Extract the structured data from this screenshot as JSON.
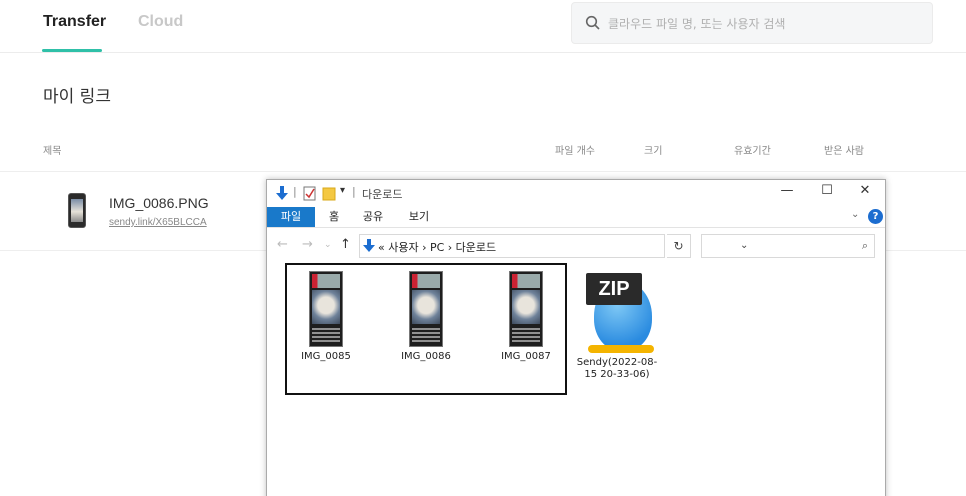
{
  "header": {
    "tabs": [
      {
        "label": "Transfer",
        "active": true
      },
      {
        "label": "Cloud",
        "active": false
      }
    ],
    "search_placeholder": "클라우드 파일 명, 또는 사용자 검색"
  },
  "main": {
    "title": "마이 링크",
    "columns": [
      "제목",
      "파일 개수",
      "크기",
      "유효기간",
      "받은 사람"
    ],
    "rows": [
      {
        "name": "IMG_0086.PNG",
        "link": "sendy.link/X65BLCCA"
      }
    ]
  },
  "explorer": {
    "title": "다운로드",
    "ribbon_tabs": [
      "파일",
      "홈",
      "공유",
      "보기"
    ],
    "address": "« 사용자 › PC › 다운로드",
    "files": [
      {
        "name": "IMG_0085"
      },
      {
        "name": "IMG_0086"
      },
      {
        "name": "IMG_0087"
      },
      {
        "name": "Sendy(2022-08-15 20-33-06)",
        "icon_text": "ZIP"
      }
    ]
  },
  "colors": {
    "accent": "#2fc0a8",
    "ribbon_file": "#1979ca"
  }
}
